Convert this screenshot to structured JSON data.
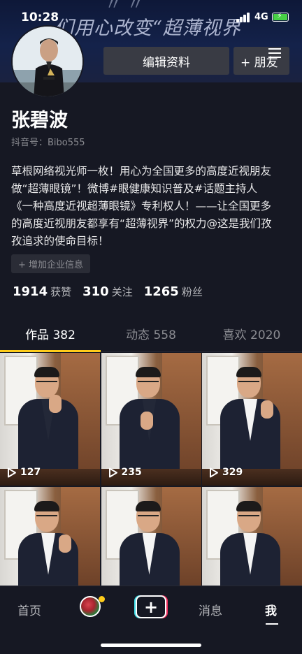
{
  "status_bar": {
    "time": "10:28",
    "network": "4G"
  },
  "banner": {
    "text": "们用心改变“超薄视界"
  },
  "profile": {
    "name": "张碧波",
    "douyin_id": "抖音号：Bibo555",
    "bio_lines": [
      "草根网络视光师一枚！用心为全国更多的高度近视朋友",
      "做“超薄眼镜”！微博#眼健康知识普及#话题主持人",
      "《一种高度近视超薄眼镜》专利权人！——让全国更多",
      "的高度近视朋友都享有“超薄视界”的权力@这是我们孜",
      "孜追求的使命目标！"
    ],
    "add_business_info": "+ 增加企业信息"
  },
  "buttons": {
    "edit_profile": "编辑资料",
    "add_friend": "+ 朋友"
  },
  "stats": [
    {
      "value": "1914",
      "label": "获赞"
    },
    {
      "value": "310",
      "label": "关注"
    },
    {
      "value": "1265",
      "label": "粉丝"
    }
  ],
  "tabs": [
    {
      "label": "作品 382",
      "active": true
    },
    {
      "label": "动态 558",
      "active": false
    },
    {
      "label": "喜欢 2020",
      "active": false
    }
  ],
  "videos": [
    {
      "plays": "127"
    },
    {
      "plays": "235"
    },
    {
      "plays": "329"
    },
    {
      "plays": ""
    },
    {
      "plays": ""
    },
    {
      "plays": ""
    }
  ],
  "bottom_nav": {
    "home": "首页",
    "messages": "消息",
    "me": "我",
    "create_icon": "plus-icon"
  },
  "colors": {
    "background": "#161823",
    "accent_tab_underline": "#fecc1a",
    "button_bg": "#393b44",
    "create_cyan": "#3fdde8",
    "create_red": "#f02c5c"
  }
}
